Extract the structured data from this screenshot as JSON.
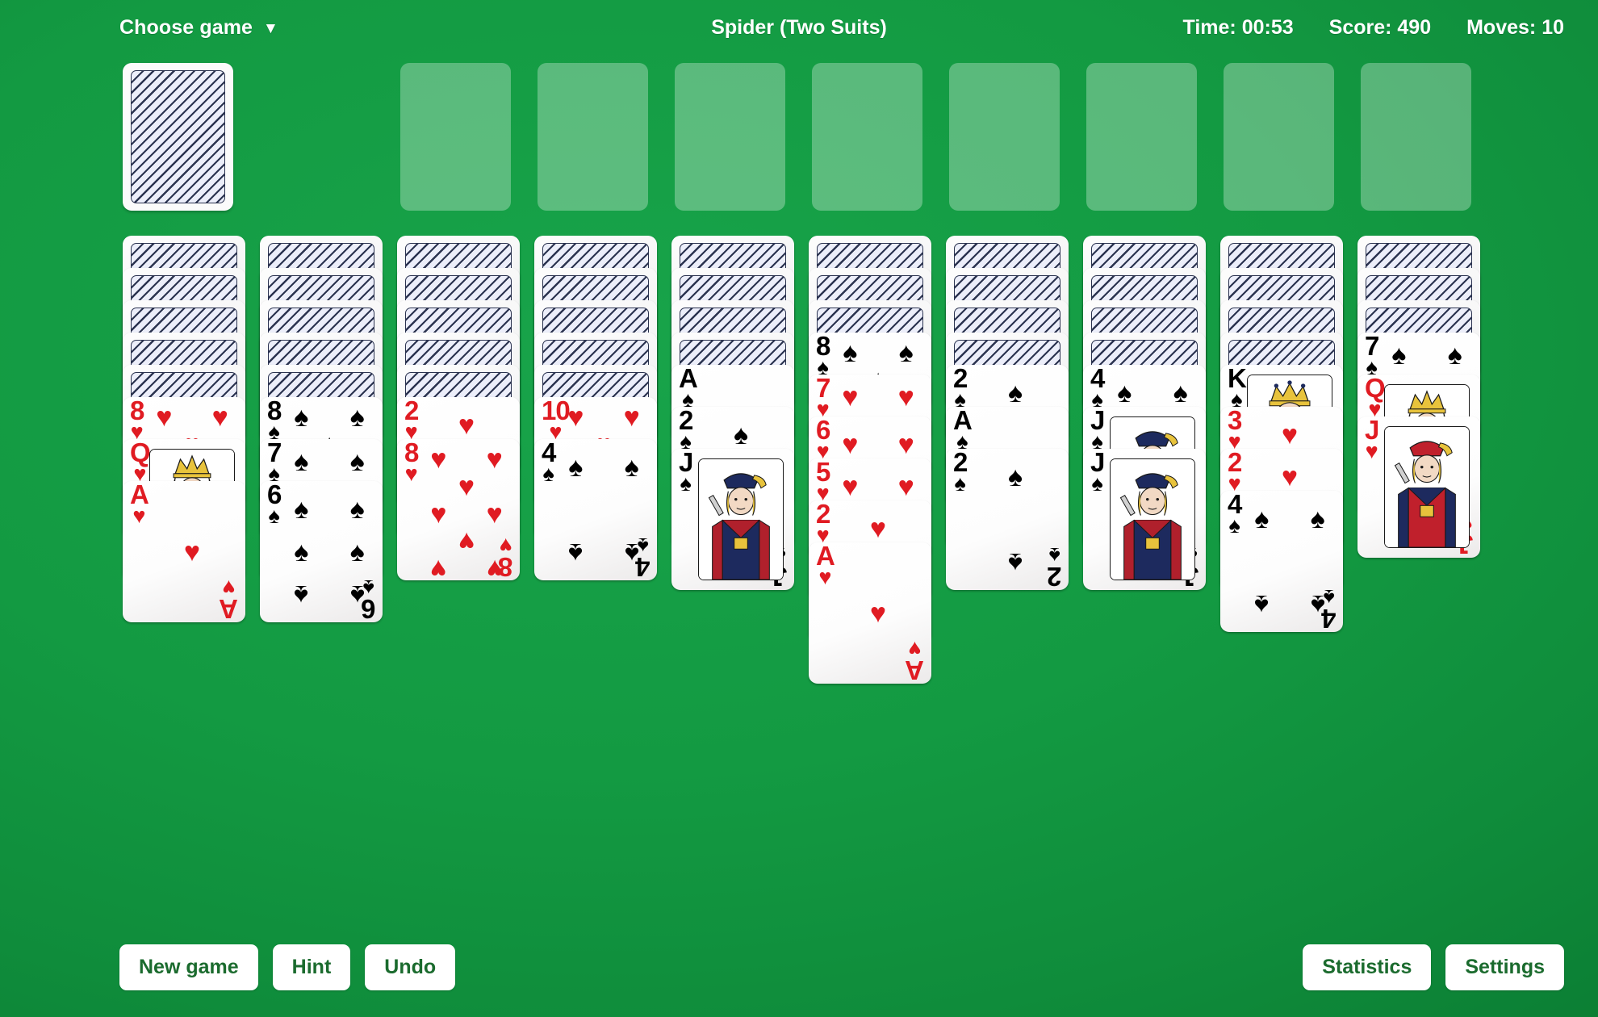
{
  "header": {
    "choose_game_label": "Choose game",
    "choose_game_caret": "▼",
    "game_title": "Spider (Two Suits)",
    "time": "Time: 00:53",
    "score": "Score: 490",
    "moves": "Moves: 10"
  },
  "board": {
    "stock": {
      "name": "stock-pile",
      "face_down": true
    },
    "foundation_count": 8,
    "columns": [
      {
        "face_down": 5,
        "face_up": [
          {
            "rank": "8",
            "suit": "hearts"
          },
          {
            "rank": "Q",
            "suit": "hearts"
          },
          {
            "rank": "A",
            "suit": "hearts"
          }
        ]
      },
      {
        "face_down": 5,
        "face_up": [
          {
            "rank": "8",
            "suit": "spades"
          },
          {
            "rank": "7",
            "suit": "spades"
          },
          {
            "rank": "6",
            "suit": "spades"
          }
        ]
      },
      {
        "face_down": 5,
        "face_up": [
          {
            "rank": "2",
            "suit": "hearts"
          },
          {
            "rank": "8",
            "suit": "hearts"
          }
        ]
      },
      {
        "face_down": 5,
        "face_up": [
          {
            "rank": "10",
            "suit": "hearts"
          },
          {
            "rank": "4",
            "suit": "spades"
          }
        ]
      },
      {
        "face_down": 4,
        "face_up": [
          {
            "rank": "A",
            "suit": "spades"
          },
          {
            "rank": "2",
            "suit": "spades"
          },
          {
            "rank": "J",
            "suit": "spades"
          }
        ]
      },
      {
        "face_down": 3,
        "face_up": [
          {
            "rank": "8",
            "suit": "spades"
          },
          {
            "rank": "7",
            "suit": "hearts"
          },
          {
            "rank": "6",
            "suit": "hearts"
          },
          {
            "rank": "5",
            "suit": "hearts"
          },
          {
            "rank": "2",
            "suit": "hearts"
          },
          {
            "rank": "A",
            "suit": "hearts"
          }
        ]
      },
      {
        "face_down": 4,
        "face_up": [
          {
            "rank": "2",
            "suit": "spades"
          },
          {
            "rank": "A",
            "suit": "spades"
          },
          {
            "rank": "2",
            "suit": "spades"
          }
        ]
      },
      {
        "face_down": 4,
        "face_up": [
          {
            "rank": "4",
            "suit": "spades"
          },
          {
            "rank": "J",
            "suit": "spades"
          },
          {
            "rank": "J",
            "suit": "spades"
          }
        ]
      },
      {
        "face_down": 4,
        "face_up": [
          {
            "rank": "K",
            "suit": "spades"
          },
          {
            "rank": "3",
            "suit": "hearts"
          },
          {
            "rank": "2",
            "suit": "hearts"
          },
          {
            "rank": "4",
            "suit": "spades"
          }
        ]
      },
      {
        "face_down": 3,
        "face_up": [
          {
            "rank": "7",
            "suit": "spades"
          },
          {
            "rank": "Q",
            "suit": "hearts"
          },
          {
            "rank": "J",
            "suit": "hearts"
          }
        ]
      }
    ]
  },
  "toolbar": {
    "new_game": "New game",
    "hint": "Hint",
    "undo": "Undo",
    "statistics": "Statistics",
    "settings": "Settings"
  },
  "colors": {
    "table_green": "#13a047",
    "card_white": "#ffffff",
    "red_suit": "#e01b22",
    "black_suit": "#000000",
    "button_text": "#1b6b2e",
    "slot_fill": "rgba(255,255,255,0.30)"
  },
  "icons": {
    "hearts_glyph": "♥",
    "spades_glyph": "♠",
    "caret_down": "▼"
  }
}
